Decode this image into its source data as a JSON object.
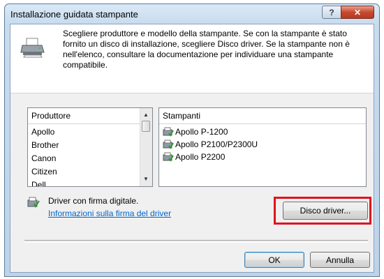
{
  "window": {
    "title": "Installazione guidata stampante",
    "help_label": "?",
    "close_label": "✕"
  },
  "header": {
    "description": "Scegliere produttore e modello della stampante. Se con la stampante è stato fornito un disco di installazione, scegliere Disco driver. Se la stampante non è nell'elenco, consultare la documentazione per individuare una stampante compatibile."
  },
  "manufacturers": {
    "header": "Produttore",
    "items": [
      "Apollo",
      "Brother",
      "Canon",
      "Citizen",
      "Dell"
    ],
    "selected": "Apollo"
  },
  "printers": {
    "header": "Stampanti",
    "items": [
      "Apollo P-1200",
      "Apollo P2100/P2300U",
      "Apollo P2200"
    ]
  },
  "signature": {
    "text": "Driver con firma digitale.",
    "link": "Informazioni sulla firma del driver"
  },
  "buttons": {
    "disk": "Disco driver...",
    "ok": "OK",
    "cancel": "Annulla"
  },
  "colors": {
    "highlight": "#e0141e",
    "link": "#0066cc"
  }
}
